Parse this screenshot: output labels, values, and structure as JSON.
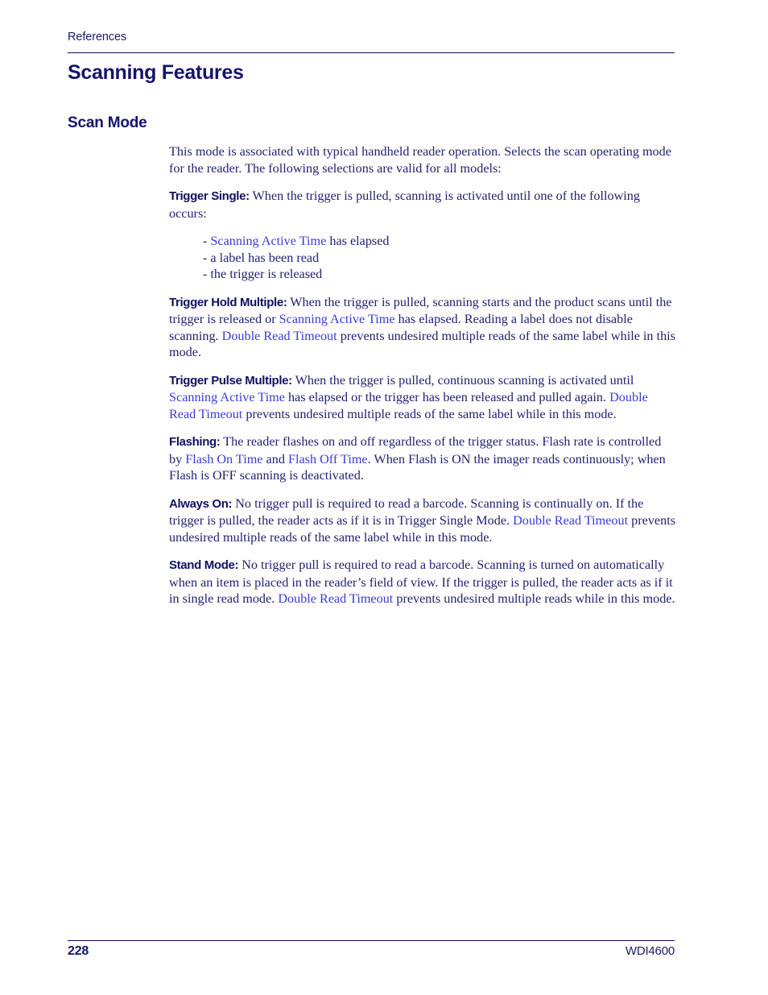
{
  "header": {
    "running_head": "References"
  },
  "chapter_title": "Scanning Features",
  "section_title": "Scan Mode",
  "colors": {
    "heading": "#14146b",
    "body_text": "#222270",
    "link": "#3b3bd4",
    "rule": "#0d0d5c"
  },
  "body": {
    "intro": "This mode is associated with typical handheld reader operation. Selects the scan operating mode for the reader. The following selections are valid for all models:",
    "trigger_single": {
      "label": "Trigger Single:",
      "text": " When the trigger is pulled, scanning is activated until one of the following occurs:",
      "bullets": [
        {
          "dash": "-",
          "link": "Scanning Active Time",
          "rest": " has elapsed"
        },
        {
          "dash": "-",
          "link": "",
          "rest": "a label has been read"
        },
        {
          "dash": "-",
          "link": "",
          "rest": "the trigger is released"
        }
      ]
    },
    "trigger_hold_multiple": {
      "label": "Trigger Hold Multiple:",
      "t1": " When the trigger is pulled, scanning starts and the product scans until the trigger is released or ",
      "link1": "Scanning Active Time",
      "t2": " has elapsed. Reading a label does not disable scanning. ",
      "link2": "Double Read Timeout",
      "t3": " prevents undesired multiple reads of the same label while in this mode."
    },
    "trigger_pulse_multiple": {
      "label": "Trigger Pulse Multiple:",
      "t1": " When the trigger is pulled, continuous scanning is activated until ",
      "link1": "Scanning Active Time",
      "t2": " has elapsed or the trigger has been released and pulled again. ",
      "link2": "Double Read Timeout",
      "t3": " prevents undesired multiple reads of the same label while in this mode."
    },
    "flashing": {
      "label": "Flashing:",
      "t1": " The reader flashes on and off regardless of the trigger status. Flash rate is controlled by ",
      "link1": "Flash On Time",
      "t2": " and ",
      "link2": "Flash Off Time",
      "t3": ". When Flash is ON the imager reads continuously; when Flash is OFF scanning is deactivated."
    },
    "always_on": {
      "label": "Always On:",
      "t1": " No trigger pull is required to read a barcode. Scanning is continually on. If the trigger is pulled, the reader acts as if it is in Trigger Single Mode. ",
      "link1": "Double Read Timeout",
      "t2": " prevents undesired multiple reads of the same label while in this mode."
    },
    "stand_mode": {
      "label": "Stand Mode:",
      "t1": " No trigger pull is required to read a barcode. Scanning is turned on automatically when an item is placed in the reader’s field of view. If the trigger is pulled, the reader acts as if it in single read mode. ",
      "link1": "Double Read Timeout",
      "t2": " prevents undesired multiple reads while in this mode."
    }
  },
  "footer": {
    "page_number": "228",
    "doc_id": "WDI4600"
  }
}
